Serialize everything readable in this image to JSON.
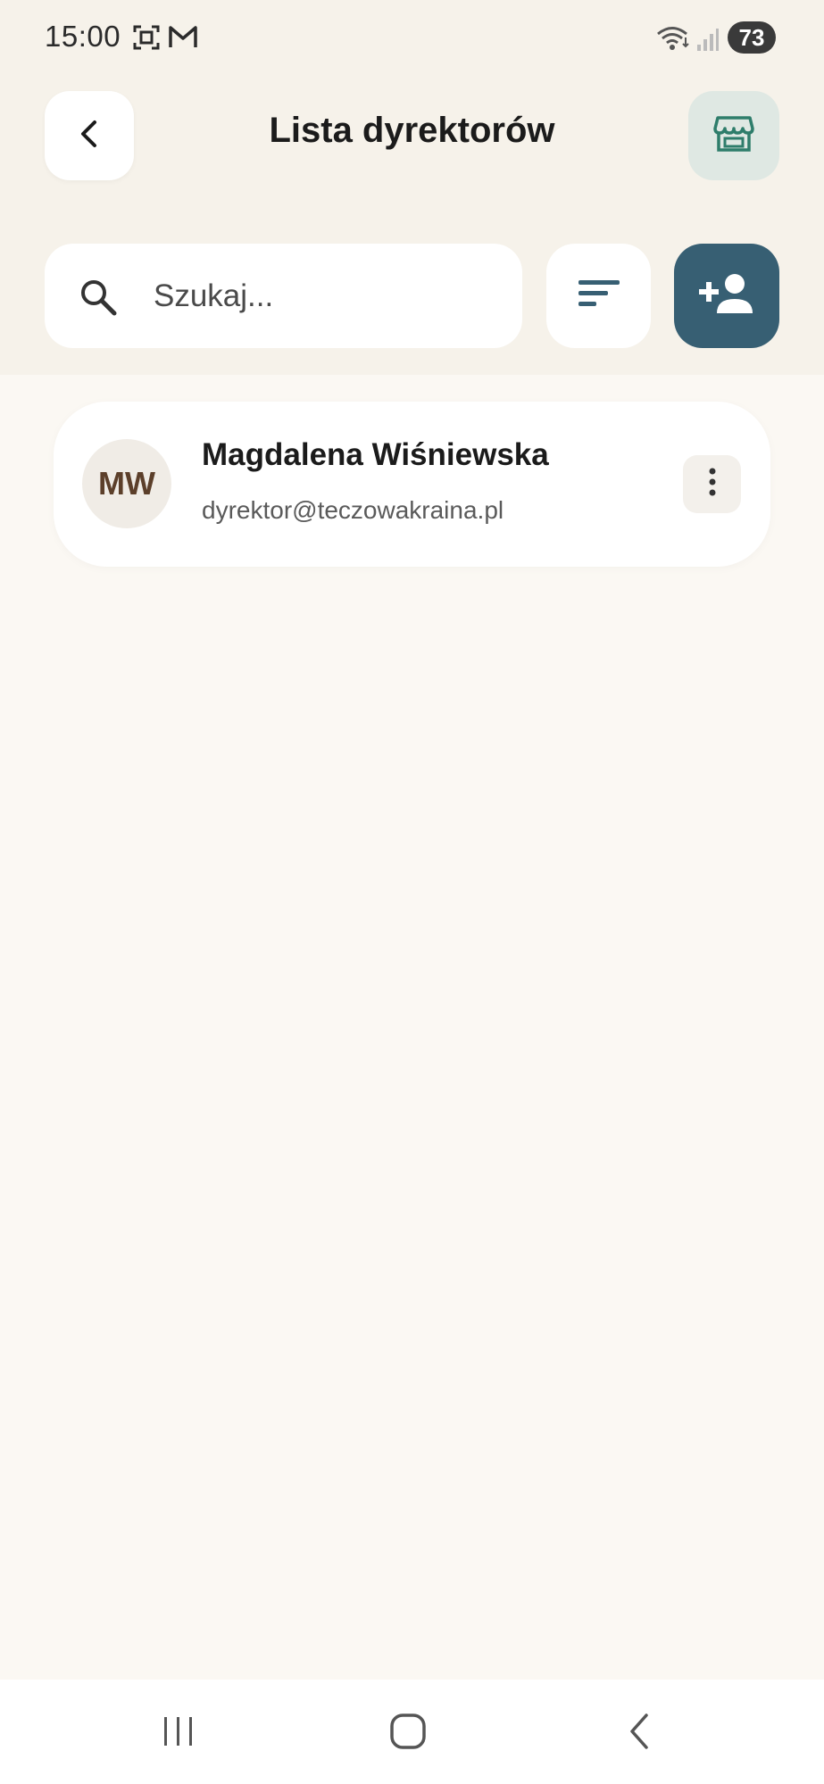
{
  "status_bar": {
    "time": "15:00",
    "battery": "73",
    "icons": [
      "screenshot-icon",
      "gmail-icon",
      "wifi-icon",
      "signal-icon",
      "battery-icon"
    ]
  },
  "header": {
    "title": "Lista dyrektorów",
    "back_icon": "chevron-left-icon",
    "store_icon": "storefront-icon"
  },
  "search": {
    "placeholder": "Szukaj...",
    "value": ""
  },
  "toolbar": {
    "sort_icon": "sort-icon",
    "add_icon": "person-add-icon"
  },
  "directors": [
    {
      "initials": "MW",
      "name": "Magdalena Wiśniewska",
      "email": "dyrektor@teczowakraina.pl"
    }
  ],
  "nav_bar": {
    "items": [
      "recent-apps-icon",
      "home-icon",
      "back-icon"
    ]
  },
  "colors": {
    "background": "#fbf8f3",
    "header_background": "#f6f2ea",
    "accent": "#375f73",
    "store_button_bg": "#dfe8e3",
    "store_icon": "#2e7d6b",
    "avatar_text": "#5c3f2a"
  }
}
